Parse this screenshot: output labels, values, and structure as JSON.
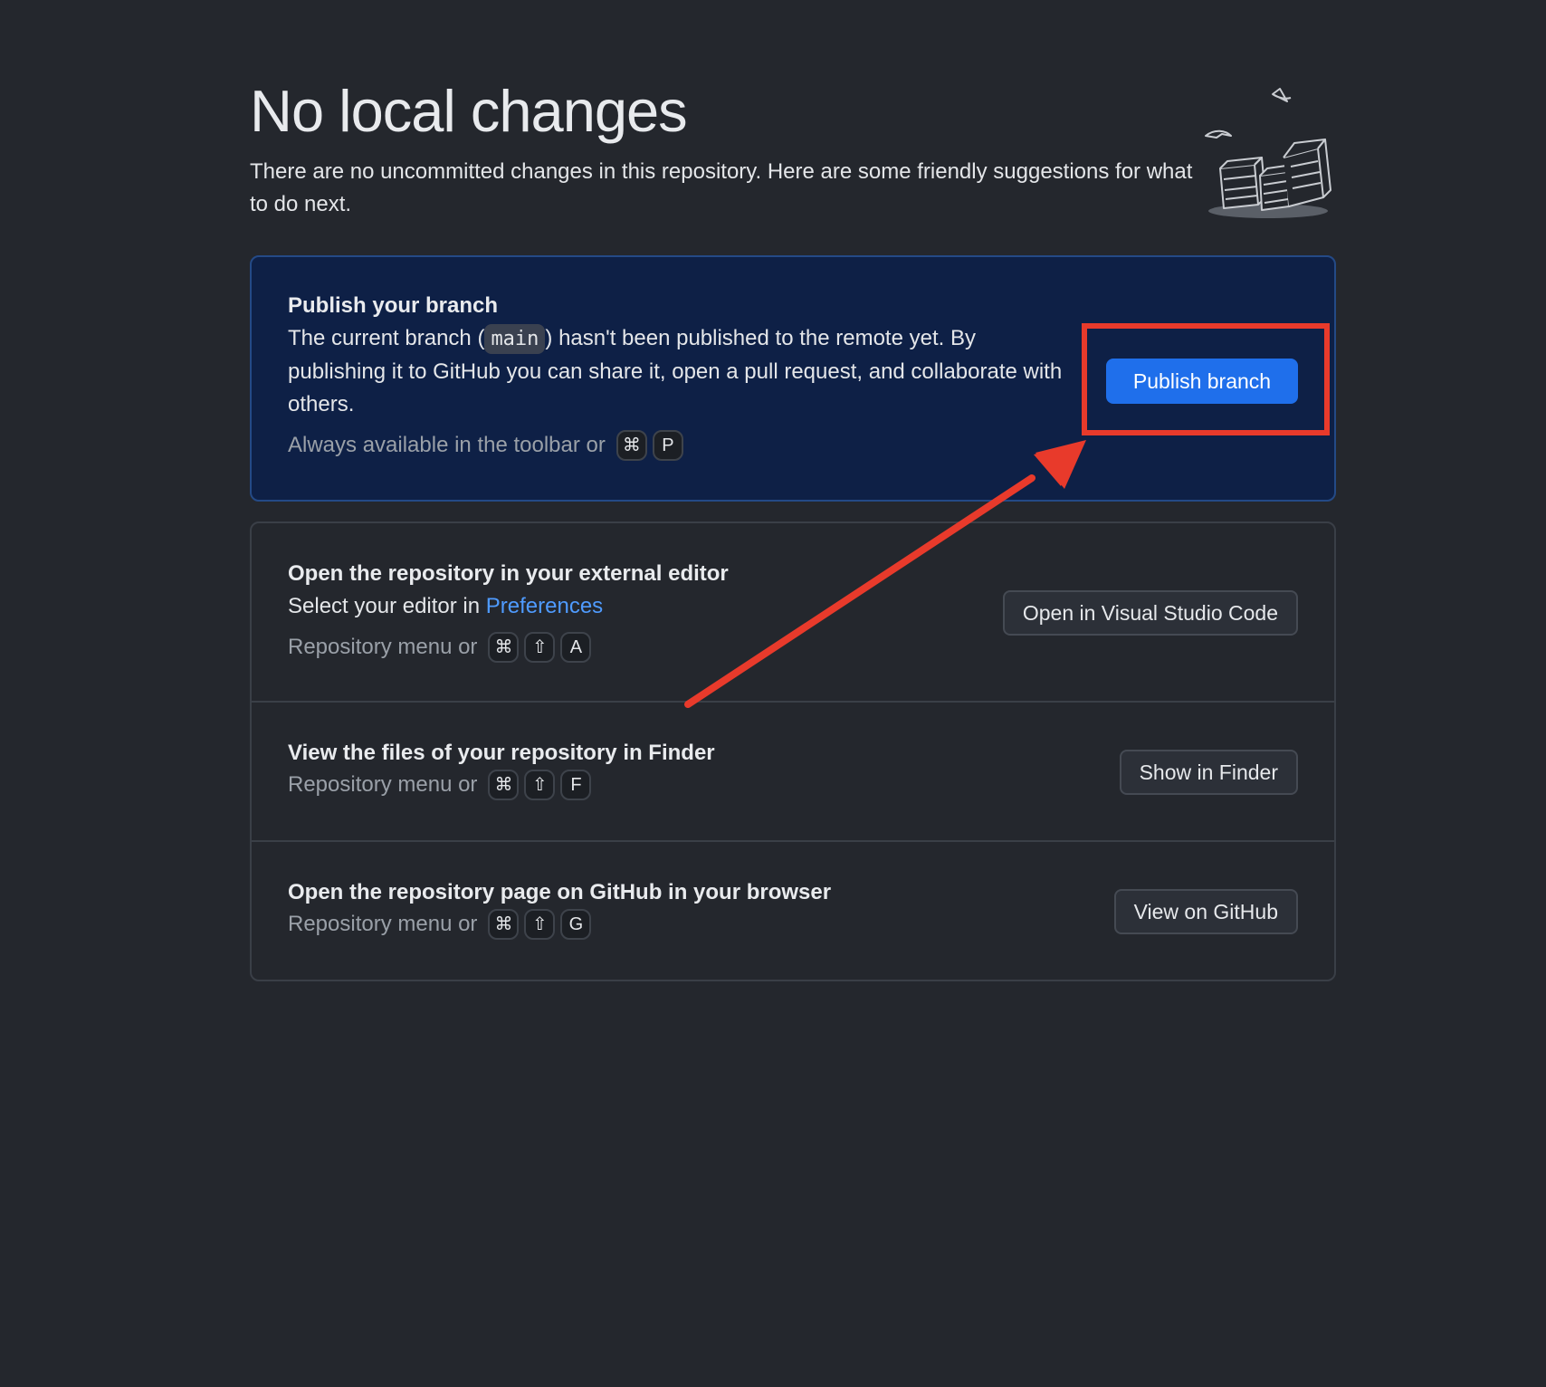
{
  "header": {
    "title": "No local changes",
    "description": "There are no uncommitted changes in this repository. Here are some friendly suggestions for what to do next."
  },
  "publish": {
    "title": "Publish your branch",
    "body_before": "The current branch (",
    "branch": "main",
    "body_after": ") hasn't been published to the remote yet. By publishing it to GitHub you can share it, open a pull request, and collaborate with others.",
    "hint": "Always available in the toolbar or",
    "keys": [
      "⌘",
      "P"
    ],
    "button": "Publish branch"
  },
  "editor": {
    "title": "Open the repository in your external editor",
    "body": "Select your editor in",
    "link": "Preferences",
    "hint": "Repository menu or",
    "keys": [
      "⌘",
      "⇧",
      "A"
    ],
    "button": "Open in Visual Studio Code"
  },
  "finder": {
    "title": "View the files of your repository in Finder",
    "hint": "Repository menu or",
    "keys": [
      "⌘",
      "⇧",
      "F"
    ],
    "button": "Show in Finder"
  },
  "github": {
    "title": "Open the repository page on GitHub in your browser",
    "hint": "Repository menu or",
    "keys": [
      "⌘",
      "⇧",
      "G"
    ],
    "button": "View on GitHub"
  },
  "colors": {
    "background": "#24272d",
    "primary_card": "#0e2046",
    "primary_button": "#1f6feb",
    "link": "#4f9bff",
    "annotation": "#e83a2b"
  }
}
